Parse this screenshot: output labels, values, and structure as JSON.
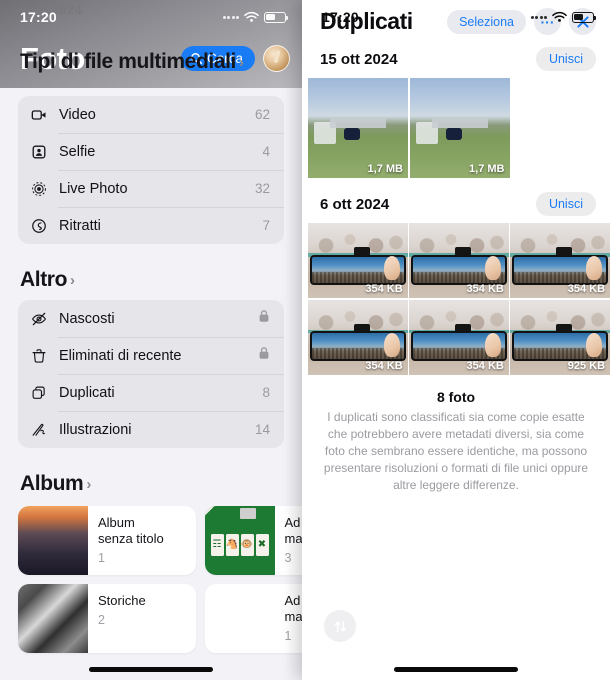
{
  "left": {
    "status": {
      "time": "17:20",
      "ghost_date": "6 ott 2024"
    },
    "app_title": "Foto",
    "search_label": "Cerca",
    "overlay_section": "Tipi di file multimediali",
    "media_types": [
      {
        "icon": "video-icon",
        "label": "Video",
        "count": "62"
      },
      {
        "icon": "selfie-icon",
        "label": "Selfie",
        "count": "4"
      },
      {
        "icon": "live-photo-icon",
        "label": "Live Photo",
        "count": "32"
      },
      {
        "icon": "portrait-icon",
        "label": "Ritratti",
        "count": "7"
      }
    ],
    "other_section": "Altro",
    "other_items": [
      {
        "icon": "eye-slash-icon",
        "label": "Nascosti",
        "locked": true,
        "count": ""
      },
      {
        "icon": "trash-icon",
        "label": "Eliminati di recente",
        "locked": true,
        "count": ""
      },
      {
        "icon": "duplicate-icon",
        "label": "Duplicati",
        "locked": false,
        "count": "8"
      },
      {
        "icon": "illustration-icon",
        "label": "Illustrazioni",
        "locked": false,
        "count": "14"
      }
    ],
    "album_section": "Album",
    "albums": [
      {
        "name": "Album\nsenza titolo",
        "count": "1",
        "thumb": "th-street"
      },
      {
        "name": "Ad\nma",
        "count": "3",
        "thumb": "th-mahjong"
      },
      {
        "name": "Storiche",
        "count": "2",
        "thumb": "th-historic"
      },
      {
        "name": "Ad\nma",
        "count": "1",
        "thumb": "th-blank"
      }
    ]
  },
  "right": {
    "status": {
      "time": "17:20"
    },
    "title": "Duplicati",
    "select_label": "Seleziona",
    "more_label": "···",
    "close_label": "✕",
    "groups": [
      {
        "date": "15 ott 2024",
        "merge_label": "Unisci",
        "style": "field",
        "photos": [
          {
            "size": "1,7 MB"
          },
          {
            "size": "1,7 MB"
          }
        ]
      },
      {
        "date": "6 ott 2024",
        "merge_label": "Unisci",
        "style": "city",
        "photos": [
          {
            "size": "354 KB"
          },
          {
            "size": "354 KB"
          },
          {
            "size": "354 KB"
          },
          {
            "size": "354 KB"
          },
          {
            "size": "354 KB"
          },
          {
            "size": "925 KB"
          }
        ]
      }
    ],
    "footer": {
      "count": "8 foto",
      "description": "I duplicati sono classificati sia come copie esatte che potrebbero avere metadati diversi, sia come foto che sembrano essere identiche, ma possono presentare risoluzioni o formati di file unici oppure altre leggere differenze."
    },
    "sort_icon": "sort-arrows-icon"
  },
  "colors": {
    "accent_blue": "#1a7cf5",
    "panel_bg": "#f2f2f7",
    "card_bg": "#e6e6ea"
  }
}
